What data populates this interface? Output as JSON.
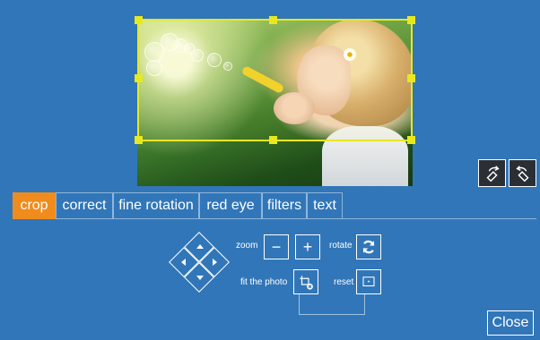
{
  "editor": {
    "tabs": [
      {
        "label": "crop",
        "active": true
      },
      {
        "label": "correct",
        "active": false
      },
      {
        "label": "fine rotation",
        "active": false
      },
      {
        "label": "red eye",
        "active": false
      },
      {
        "label": "filters",
        "active": false
      },
      {
        "label": "text",
        "active": false
      }
    ],
    "controls": {
      "zoom_label": "zoom",
      "zoom_out_label": "−",
      "zoom_in_label": "+",
      "rotate_label": "rotate",
      "fit_label": "fit the photo",
      "reset_label": "reset"
    },
    "close_label": "Close",
    "icons": {
      "rotate_left": "rotate-left-icon",
      "rotate_right": "rotate-right-icon",
      "rotate": "refresh-icon",
      "fit": "crop-fit-icon",
      "reset": "reset-frame-icon",
      "pan_up": "arrow-up-icon",
      "pan_down": "arrow-down-icon",
      "pan_left": "arrow-left-icon",
      "pan_right": "arrow-right-icon"
    },
    "colors": {
      "background": "#3176b8",
      "active_tab": "#f08c1d",
      "crop_frame": "#e8e820"
    }
  }
}
